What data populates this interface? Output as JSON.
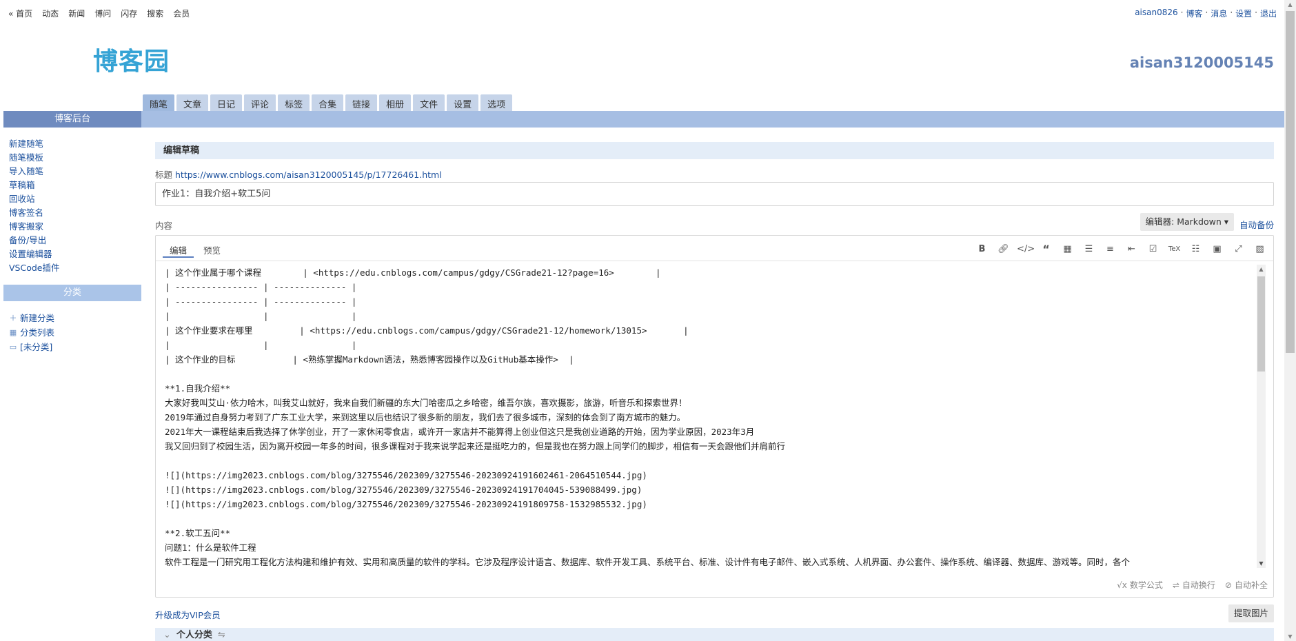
{
  "topnav": {
    "items": [
      "« 首页",
      "动态",
      "新闻",
      "博问",
      "闪存",
      "搜索",
      "会员"
    ]
  },
  "user": {
    "name": "aisan0826",
    "links": [
      "博客",
      "消息",
      "设置",
      "退出"
    ]
  },
  "header": {
    "logo": "博客园",
    "blog_name": "aisan3120005145"
  },
  "tabs": [
    "随笔",
    "文章",
    "日记",
    "评论",
    "标签",
    "合集",
    "链接",
    "相册",
    "文件",
    "设置",
    "选项"
  ],
  "sidebar": {
    "title": "博客后台",
    "items": [
      "新建随笔",
      "随笔模板",
      "导入随笔",
      "草稿箱",
      "回收站",
      "博客签名",
      "博客搬家",
      "备份/导出",
      "设置编辑器",
      "VSCode插件"
    ],
    "category_title": "分类",
    "categories": [
      {
        "icon": "plus-icon",
        "label": "新建分类"
      },
      {
        "icon": "grid-icon",
        "label": "分类列表"
      },
      {
        "icon": "folder-icon",
        "label": "[未分类]"
      }
    ]
  },
  "main": {
    "section_title": "编辑草稿",
    "title_label": "标题",
    "title_link": "https://www.cnblogs.com/aisan3120005145/p/17726461.html",
    "title_value": "作业1：自我介绍+软工5问",
    "content_label": "内容",
    "editor_select": "编辑器: Markdown ▾",
    "autobackup": "自动备份",
    "editor_tabs": [
      "编辑",
      "预览"
    ],
    "content_lines": [
      "| 这个作业属于哪个课程        | <https://edu.cnblogs.com/campus/gdgy/CSGrade21-12?page=16>        |",
      "| ---------------- | -------------- |",
      "| ---------------- | -------------- |",
      "|                  |                |",
      "| 这个作业要求在哪里         | <https://edu.cnblogs.com/campus/gdgy/CSGrade21-12/homework/13015>       |",
      "|                  |                |",
      "| 这个作业的目标           | <熟练掌握Markdown语法，熟悉博客园操作以及GitHub基本操作>  |",
      "",
      "**1.自我介绍**",
      "大家好我叫艾山·依力哈木，叫我艾山就好，我来自我们新疆的东大门哈密瓜之乡哈密，维吾尔族，喜欢摄影，旅游，听音乐和探索世界！",
      "2019年通过自身努力考到了广东工业大学，来到这里以后也结识了很多新的朋友，我们去了很多城市，深刻的体会到了南方城市的魅力。",
      "2021年大一课程结束后我选择了休学创业，开了一家休闲零食店，或许开一家店并不能算得上创业但这只是我创业道路的开始，因为学业原因，2023年3月",
      "我又回归到了校园生活，因为离开校园一年多的时间，很多课程对于我来说学起来还是挺吃力的，但是我也在努力跟上同学们的脚步，相信有一天会跟他们并肩前行",
      "",
      "![](https://img2023.cnblogs.com/blog/3275546/202309/3275546-20230924191602461-2064510544.jpg)",
      "![](https://img2023.cnblogs.com/blog/3275546/202309/3275546-20230924191704045-539088499.jpg)",
      "![](https://img2023.cnblogs.com/blog/3275546/202309/3275546-20230924191809758-1532985532.jpg)",
      "",
      "**2.软工五问**",
      "问题1：什么是软件工程",
      "软件工程是一门研究用工程化方法构建和维护有效、实用和高质量的软件的学科。它涉及程序设计语言、数据库、软件开发工具、系统平台、标准、设计件有电子邮件、嵌入式系统、人机界面、办公套件、操作系统、编译器、数据库、游戏等。同时，各个"
    ],
    "footer_tools": [
      "数学公式",
      "自动换行",
      "自动补全"
    ],
    "vip_link": "升级成为VIP会员",
    "extract_button": "提取图片",
    "personal_category": "个人分类"
  },
  "toolbar_icons": [
    "bold-icon",
    "link-icon",
    "code-icon",
    "quote-icon",
    "table-icon",
    "unordered-list-icon",
    "ordered-list-icon",
    "indent-icon",
    "checkbox-icon",
    "tex-icon",
    "toc-icon",
    "save-icon",
    "fullscreen-icon",
    "image-icon"
  ]
}
